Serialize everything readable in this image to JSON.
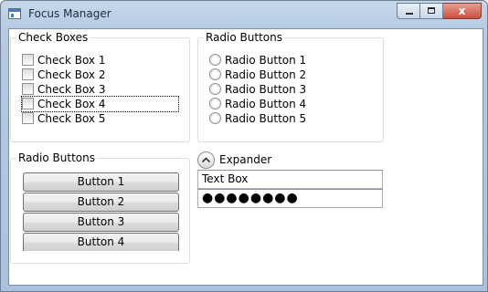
{
  "window": {
    "title": "Focus Manager",
    "close_glyph": "x"
  },
  "checkboxes_group": {
    "header": "Check Boxes",
    "items": [
      {
        "label": "Check Box 1",
        "checked": false,
        "focused": false
      },
      {
        "label": "Check Box 2",
        "checked": false,
        "focused": false
      },
      {
        "label": "Check Box 3",
        "checked": false,
        "focused": false
      },
      {
        "label": "Check Box 4",
        "checked": false,
        "focused": true
      },
      {
        "label": "Check Box 5",
        "checked": false,
        "focused": false
      }
    ]
  },
  "radio_group": {
    "header": "Radio Buttons",
    "items": [
      {
        "label": "Radio Button 1",
        "selected": false
      },
      {
        "label": "Radio Button 2",
        "selected": false
      },
      {
        "label": "Radio Button 3",
        "selected": false
      },
      {
        "label": "Radio Button 4",
        "selected": false
      },
      {
        "label": "Radio Button 5",
        "selected": false
      }
    ]
  },
  "buttons_group": {
    "header": "Radio Buttons",
    "buttons": [
      "Button 1",
      "Button 2",
      "Button 3",
      "Button 4"
    ]
  },
  "expander": {
    "label": "Expander",
    "expanded": true
  },
  "text_box": {
    "value": "Text Box"
  },
  "password_box": {
    "masked_value": "●●●●●●●●"
  },
  "colors": {
    "window_frame": "#a9c1dd",
    "close_button": "#c9503b",
    "groupbox_border": "#d5dfe5"
  }
}
